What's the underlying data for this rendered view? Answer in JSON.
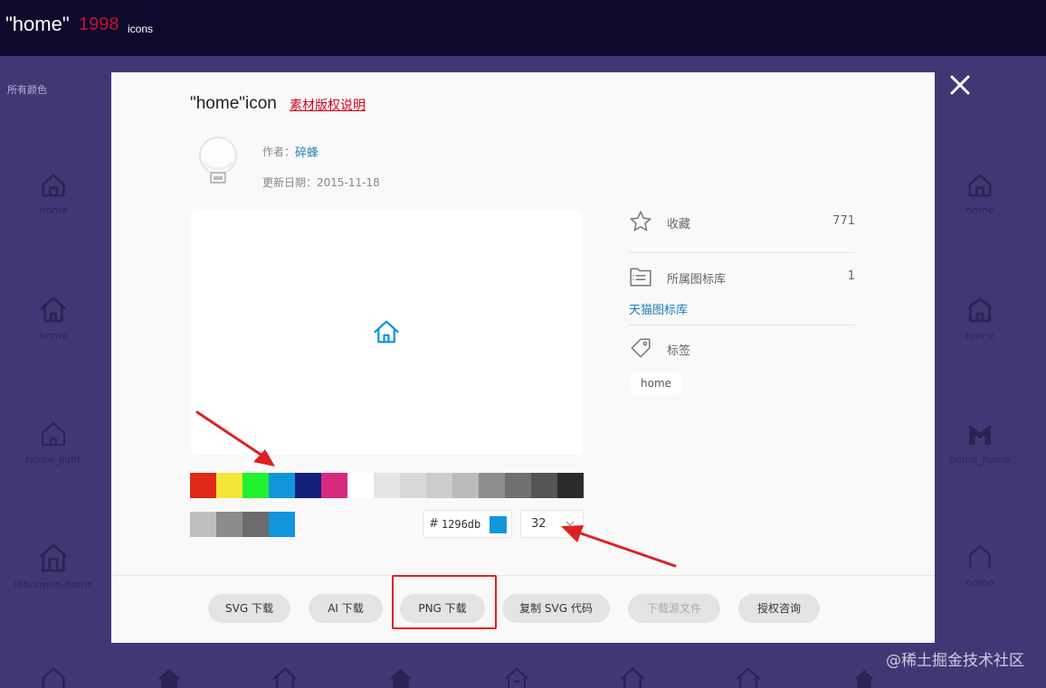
{
  "background": {
    "title": "\"home\"",
    "count": "1998",
    "unit": "icons",
    "filter_label": "所有颜色",
    "tiles_left": [
      {
        "label": "home",
        "icon": "home-outline-icon"
      },
      {
        "label": "home",
        "icon": "home-outline-icon"
      },
      {
        "label": "home_light",
        "icon": "home-light-icon"
      },
      {
        "label": "j6homem-home",
        "icon": "home-door-icon"
      }
    ],
    "tiles_right": [
      {
        "label": "home",
        "icon": "home-outline-icon"
      },
      {
        "label": "home",
        "icon": "home-rounded-icon"
      },
      {
        "label": "home_home",
        "icon": "home-m-icon"
      },
      {
        "label": "home",
        "icon": "home-thin-icon"
      }
    ],
    "watermark": "@稀土掘金技术社区",
    "colors": {
      "header": "#0d0a2e",
      "body": "#403775",
      "count": "#c8102e"
    }
  },
  "modal": {
    "title": "\"home\"icon",
    "copyright_link": "素材版权说明",
    "author_label": "作者：",
    "author_name": "碎蜂",
    "date_label": "更新日期：2015-11-18",
    "preview_color": "#1296db",
    "palette": [
      "#e02a18",
      "#f5e534",
      "#21f12f",
      "#1296db",
      "#13217d",
      "#d72a7e",
      "#ffffff",
      "#e5e5e5",
      "#d8d8d8",
      "#cccccc",
      "#bbbbbb",
      "#8e8e8e",
      "#707070",
      "#555555",
      "#2b2b2b"
    ],
    "recent_colors": [
      "#bebebe",
      "#8c8c8c",
      "#6b6b6b",
      "#1296db"
    ],
    "color_input": {
      "hash": "#",
      "value": "1296db"
    },
    "size_select": {
      "value": "32"
    },
    "sidebar": {
      "favorites_label": "收藏",
      "favorites_count": "771",
      "library_label": "所属图标库",
      "library_count": "1",
      "library_link": "天猫图标库",
      "tags_label": "标签",
      "tag": "home"
    },
    "buttons": [
      {
        "label": "SVG 下载",
        "disabled": false
      },
      {
        "label": "AI 下载",
        "disabled": false
      },
      {
        "label": "PNG 下载",
        "disabled": false
      },
      {
        "label": "复制 SVG 代码",
        "disabled": false
      },
      {
        "label": "下载源文件",
        "disabled": true
      },
      {
        "label": "授权咨询",
        "disabled": false
      }
    ]
  },
  "annotations": {
    "arrow_color": "#e02020"
  }
}
